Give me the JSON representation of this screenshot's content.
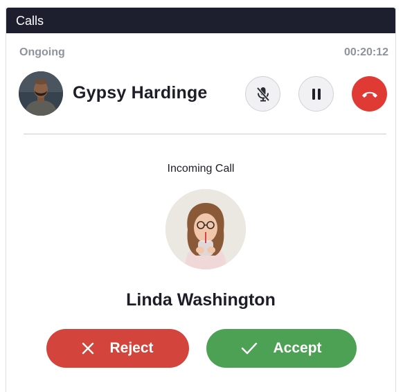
{
  "header": {
    "title": "Calls"
  },
  "ongoing": {
    "label": "Ongoing",
    "timer": "00:20:12",
    "caller_name": "Gypsy Hardinge",
    "controls": {
      "mute_icon": "microphone-off-icon",
      "hold_icon": "pause-icon",
      "hangup_icon": "phone-hangup-icon"
    }
  },
  "incoming": {
    "label": "Incoming Call",
    "caller_name": "Linda Washington",
    "reject_label": "Reject",
    "accept_label": "Accept"
  },
  "colors": {
    "header_bg": "#1d1e2e",
    "hangup_red": "#df3b34",
    "reject_red": "#d2443c",
    "accept_green": "#4da154",
    "muted_text": "#8e929b"
  }
}
